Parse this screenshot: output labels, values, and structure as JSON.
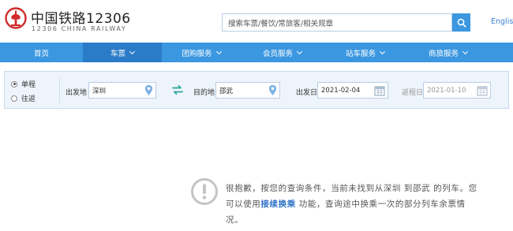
{
  "brand": {
    "title": "中国铁路12306",
    "subtitle": "12306 CHINA RAILWAY"
  },
  "header": {
    "search_placeholder": "搜索车票/餐饮/常旅客/相关规章",
    "lang_link": "English"
  },
  "nav": {
    "items": [
      {
        "label": "首页",
        "dropdown": false
      },
      {
        "label": "车票",
        "dropdown": true,
        "active": true
      },
      {
        "label": "团购服务",
        "dropdown": true
      },
      {
        "label": "会员服务",
        "dropdown": true
      },
      {
        "label": "站车服务",
        "dropdown": true
      },
      {
        "label": "商旅服务",
        "dropdown": true
      }
    ]
  },
  "query": {
    "trip_types": [
      {
        "label": "单程",
        "checked": true
      },
      {
        "label": "往返",
        "checked": false
      }
    ],
    "from_label": "出发地",
    "from_value": "深圳",
    "to_label": "目的地",
    "to_value": "邵武",
    "depart_label": "出发日",
    "depart_value": "2021-02-04",
    "return_label": "返程日",
    "return_placeholder": "2021-01-10"
  },
  "message": {
    "part1": "很抱歉，按您的查询条件，当前未找到从深圳 到邵武 的列车。您可以使用",
    "link": "接续换乘",
    "part2": " 功能，查询途中换乘一次的部分列车余票情况。"
  },
  "colors": {
    "brand_red": "#d12b2b",
    "nav_blue": "#3b97e0",
    "nav_active": "#2b7cc8",
    "link_blue": "#2f73c6"
  }
}
